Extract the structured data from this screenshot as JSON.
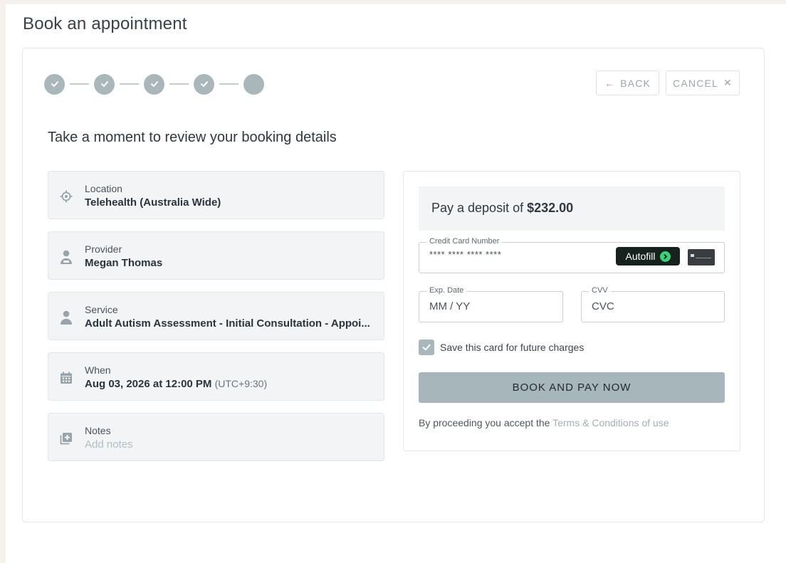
{
  "page": {
    "title": "Book an appointment"
  },
  "toolbar": {
    "back_label": "BACK",
    "cancel_label": "CANCEL"
  },
  "stepper": {
    "total_steps": 5,
    "completed_steps": 4
  },
  "review": {
    "title": "Take a moment to review your booking details",
    "items": [
      {
        "icon": "location-target-icon",
        "label": "Location",
        "value": "Telehealth (Australia Wide)"
      },
      {
        "icon": "provider-person-icon",
        "label": "Provider",
        "value": "Megan Thomas"
      },
      {
        "icon": "service-person-icon",
        "label": "Service",
        "value": "Adult Autism Assessment - Initial Consultation - Appoi..."
      },
      {
        "icon": "calendar-icon",
        "label": "When",
        "value": "Aug 03, 2026 at 12:00 PM",
        "timezone": "(UTC+9:30)"
      },
      {
        "icon": "add-note-icon",
        "label": "Notes",
        "placeholder": "Add notes"
      }
    ]
  },
  "payment": {
    "deposit_prefix": "Pay a deposit of",
    "deposit_amount": "$232.00",
    "card_number": {
      "label": "Credit Card Number",
      "value": "**** **** **** ****"
    },
    "autofill_label": "Autofill",
    "exp_date": {
      "label": "Exp. Date",
      "placeholder": "MM / YY"
    },
    "cvv": {
      "label": "CVV",
      "placeholder": "CVC"
    },
    "save_card": {
      "label": "Save this card for future charges",
      "checked": true
    },
    "submit_label": "BOOK AND PAY NOW",
    "terms_prefix": "By proceeding you accept the",
    "terms_link": "Terms & Conditions of use"
  },
  "colors": {
    "accent": "#a7b6ba",
    "background": "#f6f1ec",
    "autofill_bg": "#17211d",
    "autofill_go": "#37d27a"
  }
}
